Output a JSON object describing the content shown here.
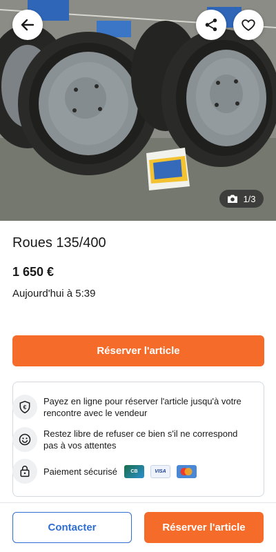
{
  "photo": {
    "alt": "Photo of four grey steel wheels with tires and Michelin boxes",
    "counter": "1/3",
    "icons": {
      "back": "arrow-left-icon",
      "share": "share-icon",
      "favorite": "heart-icon",
      "camera": "camera-icon"
    }
  },
  "listing": {
    "title": "Roues 135/400",
    "price": "1 650 €",
    "date": "Aujourd'hui à 5:39"
  },
  "actions": {
    "reserve_label": "Réserver l'article",
    "contact_label": "Contacter",
    "reserve_bottom_label": "Réserver l'article"
  },
  "info": {
    "items": [
      {
        "icon": "euro-shield-icon",
        "text": "Payez en ligne pour réserver l'article jusqu'à votre rencontre avec le vendeur"
      },
      {
        "icon": "smiley-icon",
        "text": "Restez libre de refuser ce bien s'il ne correspond pas à vos attentes"
      },
      {
        "icon": "lock-icon",
        "text": "Paiement sécurisé"
      }
    ],
    "payment_logos": [
      "CB",
      "VISA",
      "mastercard"
    ]
  },
  "colors": {
    "accent_orange": "#f56b2a",
    "link_blue": "#2f6ed3"
  }
}
